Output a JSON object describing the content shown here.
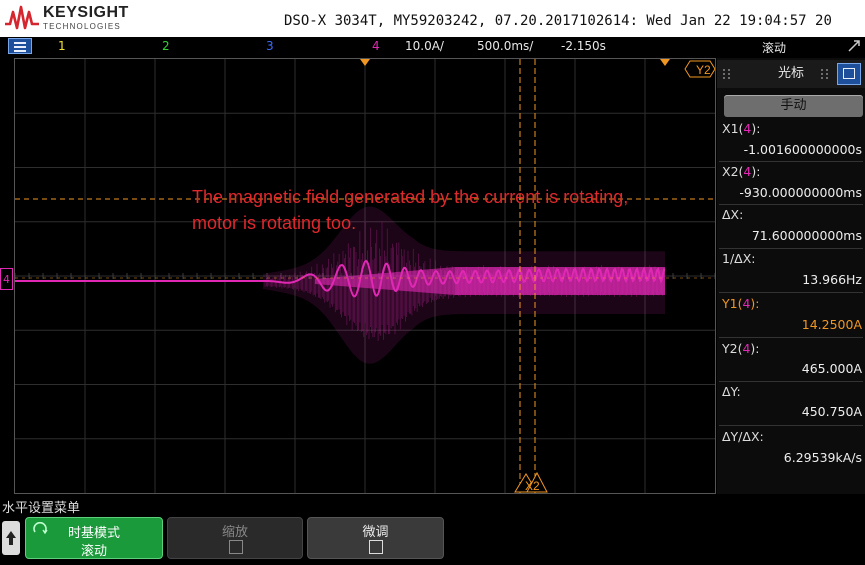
{
  "header": {
    "brand": "KEYSIGHT",
    "brand_sub": "TECHNOLOGIES",
    "model_line": "DSO-X 3034T, MY59203242, 07.20.2017102614: Wed Jan 22 19:04:57 20"
  },
  "status": {
    "ch1": "1",
    "ch2": "2",
    "ch3": "3",
    "ch4": "4",
    "scale": "10.0A/",
    "timebase": "500.0ms/",
    "delay": "-2.150s",
    "mode": "滚动"
  },
  "colors": {
    "ch1": "#f0e030",
    "ch2": "#32d232",
    "ch3": "#3a6cff",
    "ch4": "#e028b4",
    "cursor": "#f09622",
    "annotation": "#e0282d"
  },
  "plot": {
    "markers": {
      "y2": "Y2",
      "x2": "X2",
      "x1": "X1",
      "ch4": "4"
    },
    "annotation_line1": "The magnetic field generated by the current is rotating,",
    "annotation_line2": "motor is rotating too."
  },
  "sidebar": {
    "title": "光标",
    "mode_button": "手动",
    "rows": [
      {
        "label": "X1(4):",
        "value": "-1.001600000000s"
      },
      {
        "label": "X2(4):",
        "value": "-930.000000000ms"
      },
      {
        "label": "ΔX:",
        "value": "71.600000000ms"
      },
      {
        "label": "1/ΔX:",
        "value": "13.966Hz"
      },
      {
        "label": "Y1(4):",
        "value": "14.2500A"
      },
      {
        "label": "Y2(4):",
        "value": "465.000A"
      },
      {
        "label": "ΔY:",
        "value": "450.750A"
      },
      {
        "label": "ΔY/ΔX:",
        "value": "6.29539kA/s"
      }
    ]
  },
  "bottom": {
    "menu_title": "水平设置菜单",
    "softkeys": [
      {
        "label": "时基模式",
        "value": "滚动"
      },
      {
        "label": "缩放",
        "value": ""
      },
      {
        "label": "微调",
        "value": ""
      }
    ]
  }
}
